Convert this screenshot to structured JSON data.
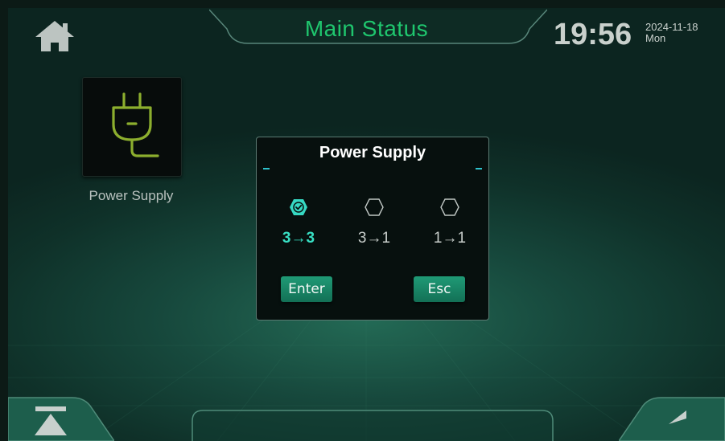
{
  "header": {
    "title": "Main Status",
    "time": "19:56",
    "date": "2024-11-18",
    "weekday": "Mon"
  },
  "icons": {
    "home": "home-icon",
    "plug": "power-plug-icon",
    "check": "check-hexagon-icon",
    "hex": "hexagon-icon",
    "top": "scroll-top-icon",
    "back": "back-arrow-icon"
  },
  "tiles": [
    {
      "label": "Power Supply"
    }
  ],
  "dialog": {
    "title": "Power Supply",
    "options": [
      {
        "label": "3→3",
        "selected": true
      },
      {
        "label": "3→1",
        "selected": false
      },
      {
        "label": "1→1",
        "selected": false
      }
    ],
    "enter_label": "Enter",
    "esc_label": "Esc"
  },
  "colors": {
    "title_green": "#1fc66e",
    "accent_teal": "#38e0c4",
    "button_green": "#1a8a6a",
    "plug_yellow": "#8cae2e"
  }
}
